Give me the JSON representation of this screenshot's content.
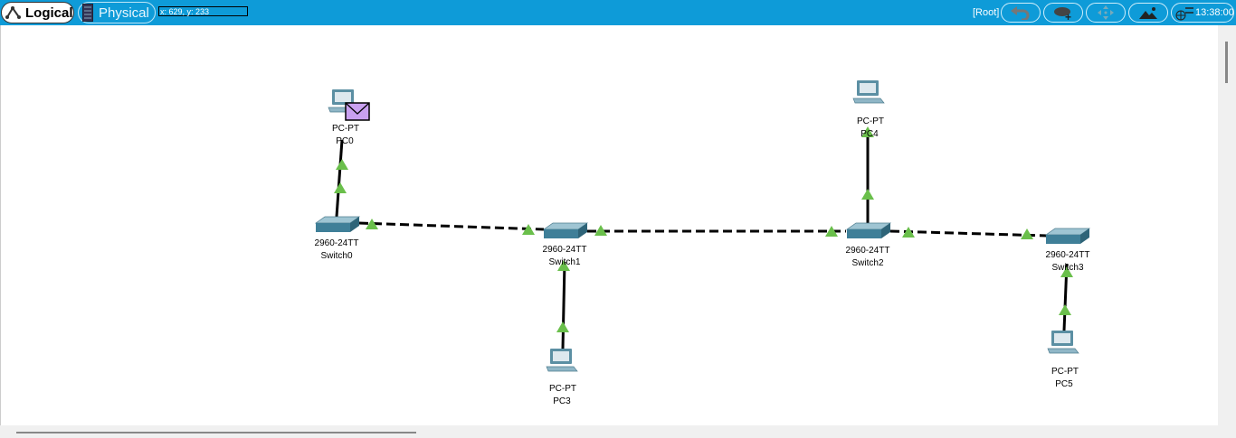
{
  "toolbar": {
    "logical_label": "Logical",
    "physical_label": "Physical",
    "coords": "x: 629, y: 233",
    "root_label": "[Root]",
    "clock": "13:38:00",
    "icons": [
      "back-icon",
      "cloud-add-icon",
      "navigate-icon",
      "background-image-icon",
      "network-globe-icon"
    ]
  },
  "devices": [
    {
      "id": "pc0",
      "model": "PC-PT",
      "name": "PC0",
      "type": "pc"
    },
    {
      "id": "pc4",
      "model": "PC-PT",
      "name": "PC4",
      "type": "pc"
    },
    {
      "id": "pc3",
      "model": "PC-PT",
      "name": "PC3",
      "type": "pc"
    },
    {
      "id": "pc5",
      "model": "PC-PT",
      "name": "PC5",
      "type": "pc"
    },
    {
      "id": "sw0",
      "model": "2960-24TT",
      "name": "Switch0",
      "type": "switch"
    },
    {
      "id": "sw1",
      "model": "2960-24TT",
      "name": "Switch1",
      "type": "switch"
    },
    {
      "id": "sw2",
      "model": "2960-24TT",
      "name": "Switch2",
      "type": "switch"
    },
    {
      "id": "sw3",
      "model": "2960-24TT",
      "name": "Switch3",
      "type": "switch"
    }
  ],
  "link_status_color": "#6abf4b",
  "pdu": {
    "device": "PC0",
    "color": "#c9a0f0"
  }
}
